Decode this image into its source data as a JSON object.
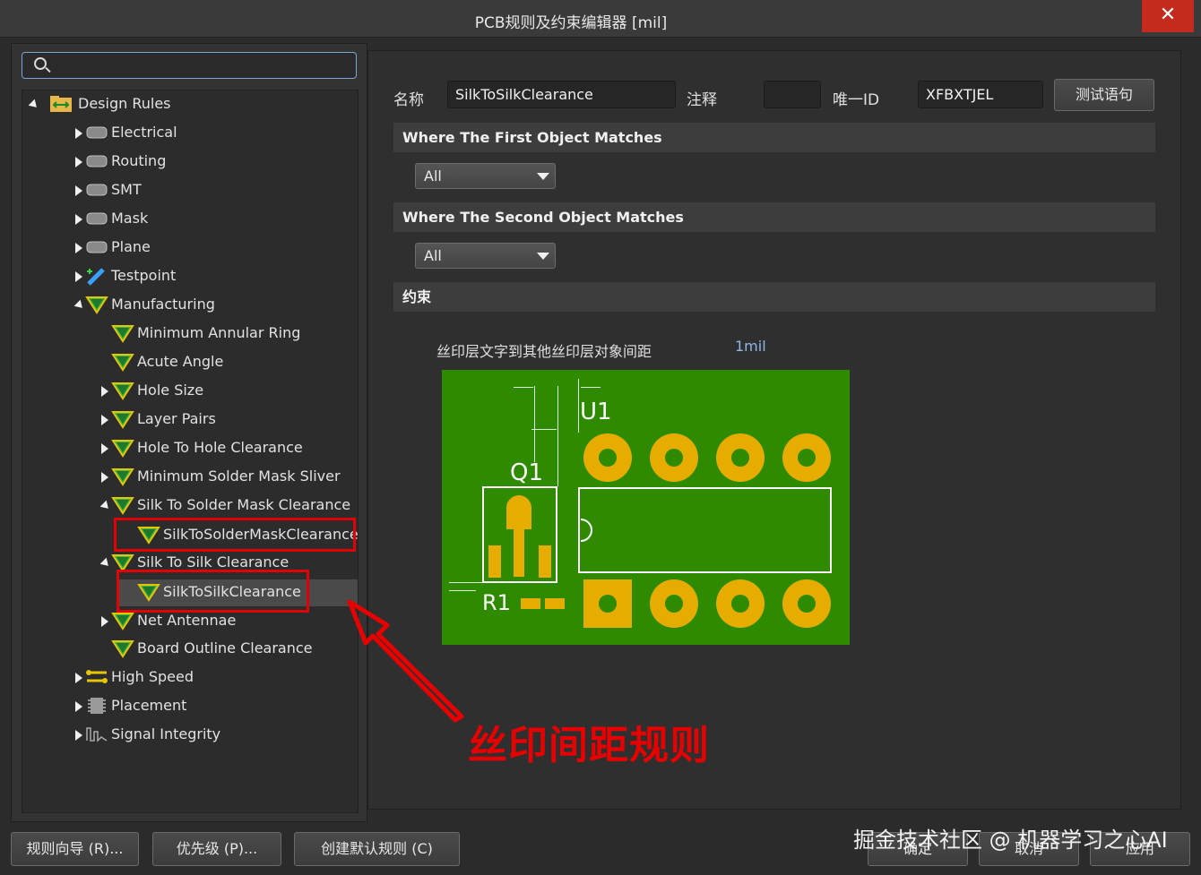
{
  "window": {
    "title": "PCB规则及约束编辑器 [mil]",
    "close_label": "✕"
  },
  "search": {
    "placeholder": ""
  },
  "tree": [
    {
      "label": "Design Rules",
      "icon": "design-rules-icon"
    },
    {
      "label": "Electrical",
      "icon": "electrical-icon"
    },
    {
      "label": "Routing",
      "icon": "routing-icon"
    },
    {
      "label": "SMT",
      "icon": "smt-icon"
    },
    {
      "label": "Mask",
      "icon": "mask-icon"
    },
    {
      "label": "Plane",
      "icon": "plane-icon"
    },
    {
      "label": "Testpoint",
      "icon": "testpoint-icon"
    },
    {
      "label": "Manufacturing",
      "icon": "manufacturing-icon"
    },
    {
      "label": "Minimum Annular Ring",
      "icon": "rule-icon"
    },
    {
      "label": "Acute Angle",
      "icon": "rule-icon"
    },
    {
      "label": "Hole Size",
      "icon": "rule-icon"
    },
    {
      "label": "Layer Pairs",
      "icon": "rule-icon"
    },
    {
      "label": "Hole To Hole Clearance",
      "icon": "rule-icon"
    },
    {
      "label": "Minimum Solder Mask Sliver",
      "icon": "rule-icon"
    },
    {
      "label": "Silk To Solder Mask Clearance",
      "icon": "rule-icon"
    },
    {
      "label": "SilkToSolderMaskClearance",
      "icon": "rule-icon"
    },
    {
      "label": "Silk To Silk Clearance",
      "icon": "rule-icon"
    },
    {
      "label": "SilkToSilkClearance",
      "icon": "rule-icon"
    },
    {
      "label": "Net Antennae",
      "icon": "rule-icon"
    },
    {
      "label": "Board Outline Clearance",
      "icon": "rule-icon"
    },
    {
      "label": "High Speed",
      "icon": "high-speed-icon"
    },
    {
      "label": "Placement",
      "icon": "placement-icon"
    },
    {
      "label": "Signal Integrity",
      "icon": "signal-integrity-icon"
    }
  ],
  "rule": {
    "name_label": "名称",
    "name_value": "SilkToSilkClearance",
    "comment_label": "注释",
    "comment_value": "",
    "id_label": "唯一ID",
    "id_value": "XFBXTJEL",
    "test_button": "测试语句"
  },
  "first_match": {
    "header": "Where The First Object Matches",
    "value": "All"
  },
  "second_match": {
    "header": "Where The Second Object Matches",
    "value": "All"
  },
  "constraints": {
    "header": "约束",
    "label": "丝印层文字到其他丝印层对象间距",
    "value": "1mil",
    "pcb_labels": {
      "u1": "U1",
      "q1": "Q1",
      "r1": "R1"
    }
  },
  "buttons": {
    "wizard": "规则向导 (R)...",
    "priority": "优先级 (P)...",
    "create_default": "创建默认规则 (C)",
    "ok": "确定",
    "cancel": "取消",
    "apply": "应用"
  },
  "annotation": {
    "text": "丝印间距规则"
  },
  "watermark": {
    "text": "掘金技术社区 @ 机器学习之心AI"
  },
  "colors": {
    "pcb_green": "#2e8b00",
    "pad_gold": "#e6ac00",
    "highlight_red": "#e30000"
  }
}
